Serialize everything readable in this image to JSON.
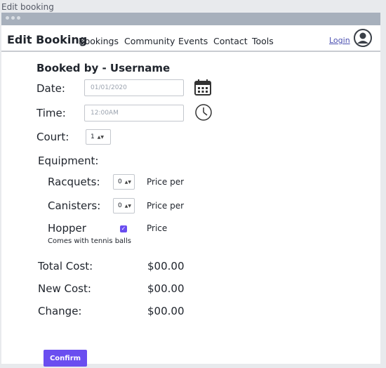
{
  "window": {
    "title": "Edit booking"
  },
  "navbar": {
    "brand": "Edit Booking",
    "links": [
      "Bookings",
      "Community",
      "Events",
      "Contact",
      "Tools"
    ],
    "login": "Login"
  },
  "form": {
    "heading": "Booked by - Username",
    "date": {
      "label": "Date:",
      "placeholder": "01/01/2020",
      "icon": "calendar-icon"
    },
    "time": {
      "label": "Time:",
      "placeholder": "12:00AM",
      "icon": "clock-icon"
    },
    "court": {
      "label": "Court:",
      "value": "1"
    },
    "equipment": {
      "label": "Equipment:",
      "racquets": {
        "label": "Racquets:",
        "value": "0",
        "price": "Price per"
      },
      "canisters": {
        "label": "Canisters:",
        "value": "0",
        "price": "Price per"
      },
      "hopper": {
        "label": "Hopper",
        "checked": true,
        "price": "Price",
        "note": "Comes with tennis balls"
      }
    },
    "costs": {
      "total_label": "Total Cost:",
      "total_value": "$00.00",
      "new_label": "New Cost:",
      "new_value": "$00.00",
      "change_label": "Change:",
      "change_value": "$00.00"
    },
    "confirm_label": "Confirm"
  },
  "colors": {
    "accent": "#6a4ef0",
    "titlebar": "#a7b0bc",
    "text": "#20252d"
  }
}
